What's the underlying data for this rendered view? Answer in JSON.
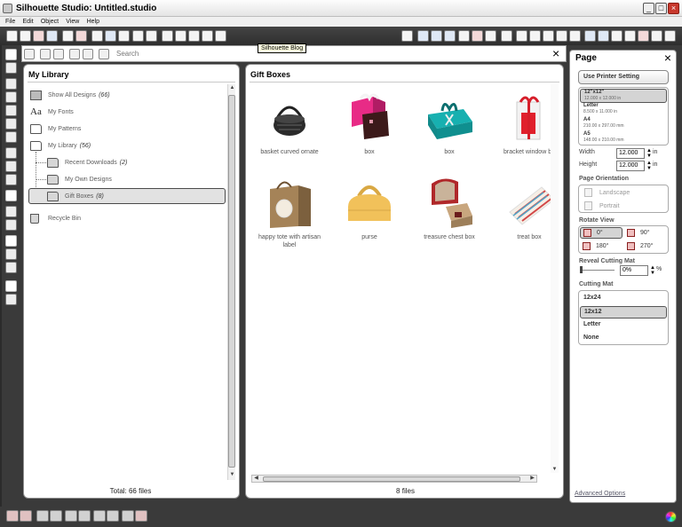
{
  "window": {
    "title": "Silhouette Studio: Untitled.studio"
  },
  "menu": [
    "File",
    "Edit",
    "Object",
    "View",
    "Help"
  ],
  "tooltip": "Silhouette Blog",
  "search": {
    "placeholder": "Search"
  },
  "library": {
    "title": "My Library",
    "items": [
      {
        "label": "Show All Designs",
        "count": "(66)"
      },
      {
        "label": "My Fonts",
        "count": ""
      },
      {
        "label": "My Patterns",
        "count": ""
      },
      {
        "label": "My Library",
        "count": "(56)"
      },
      {
        "label": "Recent Downloads",
        "count": "(2)"
      },
      {
        "label": "My Own Designs",
        "count": ""
      },
      {
        "label": "Gift Boxes",
        "count": "(8)"
      },
      {
        "label": "Recycle Bin",
        "count": ""
      }
    ],
    "footer": "Total: 66 files"
  },
  "gallery": {
    "title": "Gift Boxes",
    "items": [
      {
        "label": "basket curved ornate",
        "icon": "ornate-basket-thumbnail"
      },
      {
        "label": "box",
        "icon": "pink-box-thumbnail"
      },
      {
        "label": "box",
        "icon": "teal-box-thumbnail"
      },
      {
        "label": "bracket window bo",
        "icon": "window-box-thumbnail"
      },
      {
        "label": "happy tote with artisan label",
        "icon": "tote-thumbnail"
      },
      {
        "label": "purse",
        "icon": "purse-thumbnail"
      },
      {
        "label": "treasure chest box",
        "icon": "chest-thumbnail"
      },
      {
        "label": "treat box",
        "icon": "treat-box-thumbnail"
      }
    ],
    "footer": "8 files"
  },
  "page_panel": {
    "title": "Page",
    "printer_button": "Use Printer Setting",
    "sizes": [
      {
        "name": "12\"x12\"",
        "dims": "12.000 x 12.000 in",
        "selected": true
      },
      {
        "name": "Letter",
        "dims": "8.500 x 11.000 in",
        "selected": false
      },
      {
        "name": "A4",
        "dims": "210.00 x 297.00 mm",
        "selected": false
      },
      {
        "name": "A5",
        "dims": "148.00 x 210.00 mm",
        "selected": false
      }
    ],
    "width_label": "Width",
    "width_value": "12.000",
    "height_label": "Height",
    "height_value": "12.000",
    "unit": "in",
    "orientation_label": "Page Orientation",
    "orientations": [
      "Landscape",
      "Portrait"
    ],
    "rotate_label": "Rotate View",
    "rotations": [
      "0°",
      "90°",
      "180°",
      "270°"
    ],
    "reveal_label": "Reveal Cutting Mat",
    "reveal_value": "0%",
    "reveal_unit": "%",
    "mat_label": "Cutting Mat",
    "mats": [
      "12x24",
      "12x12",
      "Letter",
      "None"
    ],
    "selected_mat": "12x12",
    "advanced_link": "Advanced Options"
  }
}
